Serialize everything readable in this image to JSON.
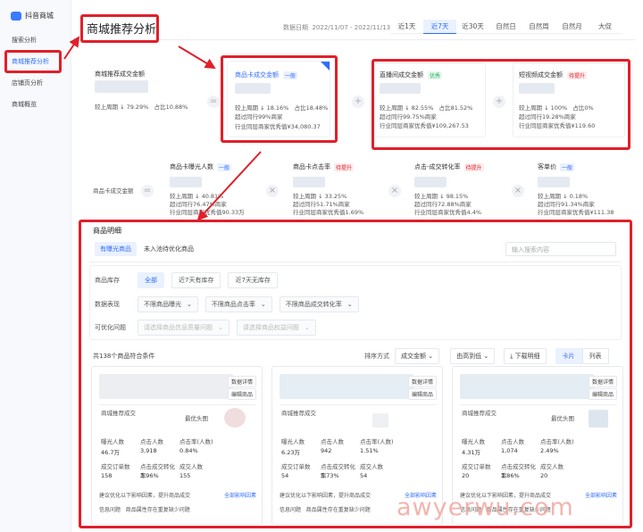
{
  "sidebar": {
    "brand": "抖音商城",
    "items": [
      {
        "label": "搜索分析",
        "active": false
      },
      {
        "label": "商城推荐分析",
        "active": true
      },
      {
        "label": "店铺页分析",
        "active": false
      },
      {
        "label": "商城概览",
        "active": false
      }
    ]
  },
  "header": {
    "title": "商城推荐分析",
    "date_label": "数据日期",
    "date_range": "2022/11/07 - 2022/11/13",
    "date_tabs": [
      {
        "label": "近1天",
        "active": false
      },
      {
        "label": "近7天",
        "active": true
      },
      {
        "label": "近30天",
        "active": false
      },
      {
        "label": "自然日",
        "active": false
      },
      {
        "label": "自然周",
        "active": false
      },
      {
        "label": "自然月",
        "active": false
      },
      {
        "label": "大促",
        "active": false
      }
    ]
  },
  "funnel_top": {
    "total": {
      "title": "商城推荐成交金额",
      "line1": "较上周期 ↓ 79.29%",
      "line1b": "占比10.88%"
    },
    "card_gmv": {
      "title": "商品卡成交金额",
      "tag": "一般",
      "line1": "较上周期 ↓ 18.16%",
      "line1b": "占比18.48%",
      "line2": "超过同行99%商家",
      "line3": "行业同层商家优秀值¥34,080.37"
    },
    "live_gmv": {
      "title": "直播间成交金额",
      "tag": "优秀",
      "line1": "较上周期 ↓ 82.55%",
      "line1b": "占比81.52%",
      "line2": "超过同行99.75%商家",
      "line3": "行业同层商家优秀值¥109,267.53"
    },
    "video_gmv": {
      "title": "短视频成交金额",
      "tag": "待提升",
      "line1": "较上周期 ↓ 100%",
      "line1b": "占比0%",
      "line2": "超过同行19.28%商家",
      "line3": "行业同层商家优秀值¥119.60"
    }
  },
  "funnel_sub": {
    "left_label": "商品卡成交金额",
    "metrics": [
      {
        "title": "商品卡曝光人数",
        "tag": "一般",
        "tag_type": "blue",
        "line1": "较上周期 ↓ 40.81%",
        "line2": "超过同行76.47%商家",
        "line3": "行业同层商家优秀值90.33万"
      },
      {
        "title": "商品卡点击率",
        "tag": "待提升",
        "tag_type": "red",
        "line1": "较上周期 ↓ 33.25%",
        "line2": "超过同行51.71%商家",
        "line3": "行业同层商家优秀值1.69%"
      },
      {
        "title": "点击-成交转化率",
        "tag": "待提升",
        "tag_type": "red",
        "line1": "较上周期 ↓ 98.15%",
        "line2": "超过同行72.88%商家",
        "line3": "行业同层商家优秀值4.4%"
      },
      {
        "title": "客单价",
        "tag": "一般",
        "tag_type": "blue",
        "line1": "较上周期 ↓ 0.18%",
        "line2": "超过同行91.34%商家",
        "line3": "行业同层商家优秀值¥111.38"
      }
    ]
  },
  "detail": {
    "title": "商品明细",
    "tabs": [
      {
        "label": "有曝光商品",
        "active": true
      },
      {
        "label": "未入池待优化商品",
        "active": false
      }
    ],
    "search_placeholder": "输入搜索内容",
    "stock": {
      "label": "商品库存",
      "options": [
        {
          "label": "全部",
          "active": true
        },
        {
          "label": "近7天有库存",
          "active": false
        },
        {
          "label": "近7天无库存",
          "active": false
        }
      ]
    },
    "performance": {
      "label": "数据表现",
      "selects": [
        "不限商品曝光",
        "不限商品点击率",
        "不限商品成交转化率"
      ]
    },
    "optimize": {
      "label": "可优化问题",
      "selects": [
        "请选择商品信息质量问题",
        "请选择商品权益问题"
      ]
    },
    "count_text": "共138个商品符合条件",
    "sort_label": "排序方式",
    "sort_value": "成交金额",
    "order_value": "由高到低",
    "download_label": "下载明细",
    "view_card": "卡片",
    "view_list": "列表"
  },
  "product_cards": [
    {
      "btn1": "数据详情",
      "btn2": "编辑商品",
      "sales_title": "商城推荐成交",
      "main_img_label": "最优头图",
      "row1_labels": [
        "曝光人数",
        "点击人数",
        "点击率(人数)"
      ],
      "row1_values": [
        "46.7万",
        "3,918",
        "0.84%"
      ],
      "row2_labels": [
        "成交订单数",
        "点击成交转化率",
        "成交人数"
      ],
      "row2_values": [
        "158",
        "3.96%",
        "155"
      ],
      "advice": "建议优化以下影响因素，提升商品成交",
      "advice_link": "全部影响因素",
      "issue1": "信息问题",
      "issue2": "商品属性存在重复缺少问题"
    },
    {
      "btn1": "数据详情",
      "btn2": "编辑商品",
      "sales_title": "商城推荐成交",
      "main_img_label": "",
      "row1_labels": [
        "曝光人数",
        "点击人数",
        "点击率(人数)"
      ],
      "row1_values": [
        "6.23万",
        "942",
        "1.51%"
      ],
      "row2_labels": [
        "成交订单数",
        "点击成交转化率",
        "成交人数"
      ],
      "row2_values": [
        "54",
        "5.73%",
        "54"
      ],
      "advice": "建议优化以下影响因素，提升商品成交",
      "advice_link": "全部影响因素",
      "issue1": "信息问题",
      "issue2": "商品属性存在重复缺少问题"
    },
    {
      "btn1": "数据详情",
      "btn2": "编辑商品",
      "sales_title": "商城推荐成交",
      "main_img_label": "最优头图",
      "row1_labels": [
        "曝光人数",
        "点击人数",
        "点击率(人数)"
      ],
      "row1_values": [
        "4.31万",
        "1,074",
        "2.49%"
      ],
      "row2_labels": [
        "成交订单数",
        "点击成交转化率",
        "成交人数"
      ],
      "row2_values": [
        "20",
        "1.86%",
        "20"
      ],
      "advice": "建议优化以下影响因素，提升商品成交",
      "advice_link": "全部影响因素",
      "issue1": "信息问题",
      "issue2": "商品属性存在重复缺少问题"
    }
  ],
  "watermark": "awyerwu.com",
  "colors": {
    "accent": "#2f6dff",
    "annotation_red": "#e0202a",
    "good": "#20b05a"
  }
}
